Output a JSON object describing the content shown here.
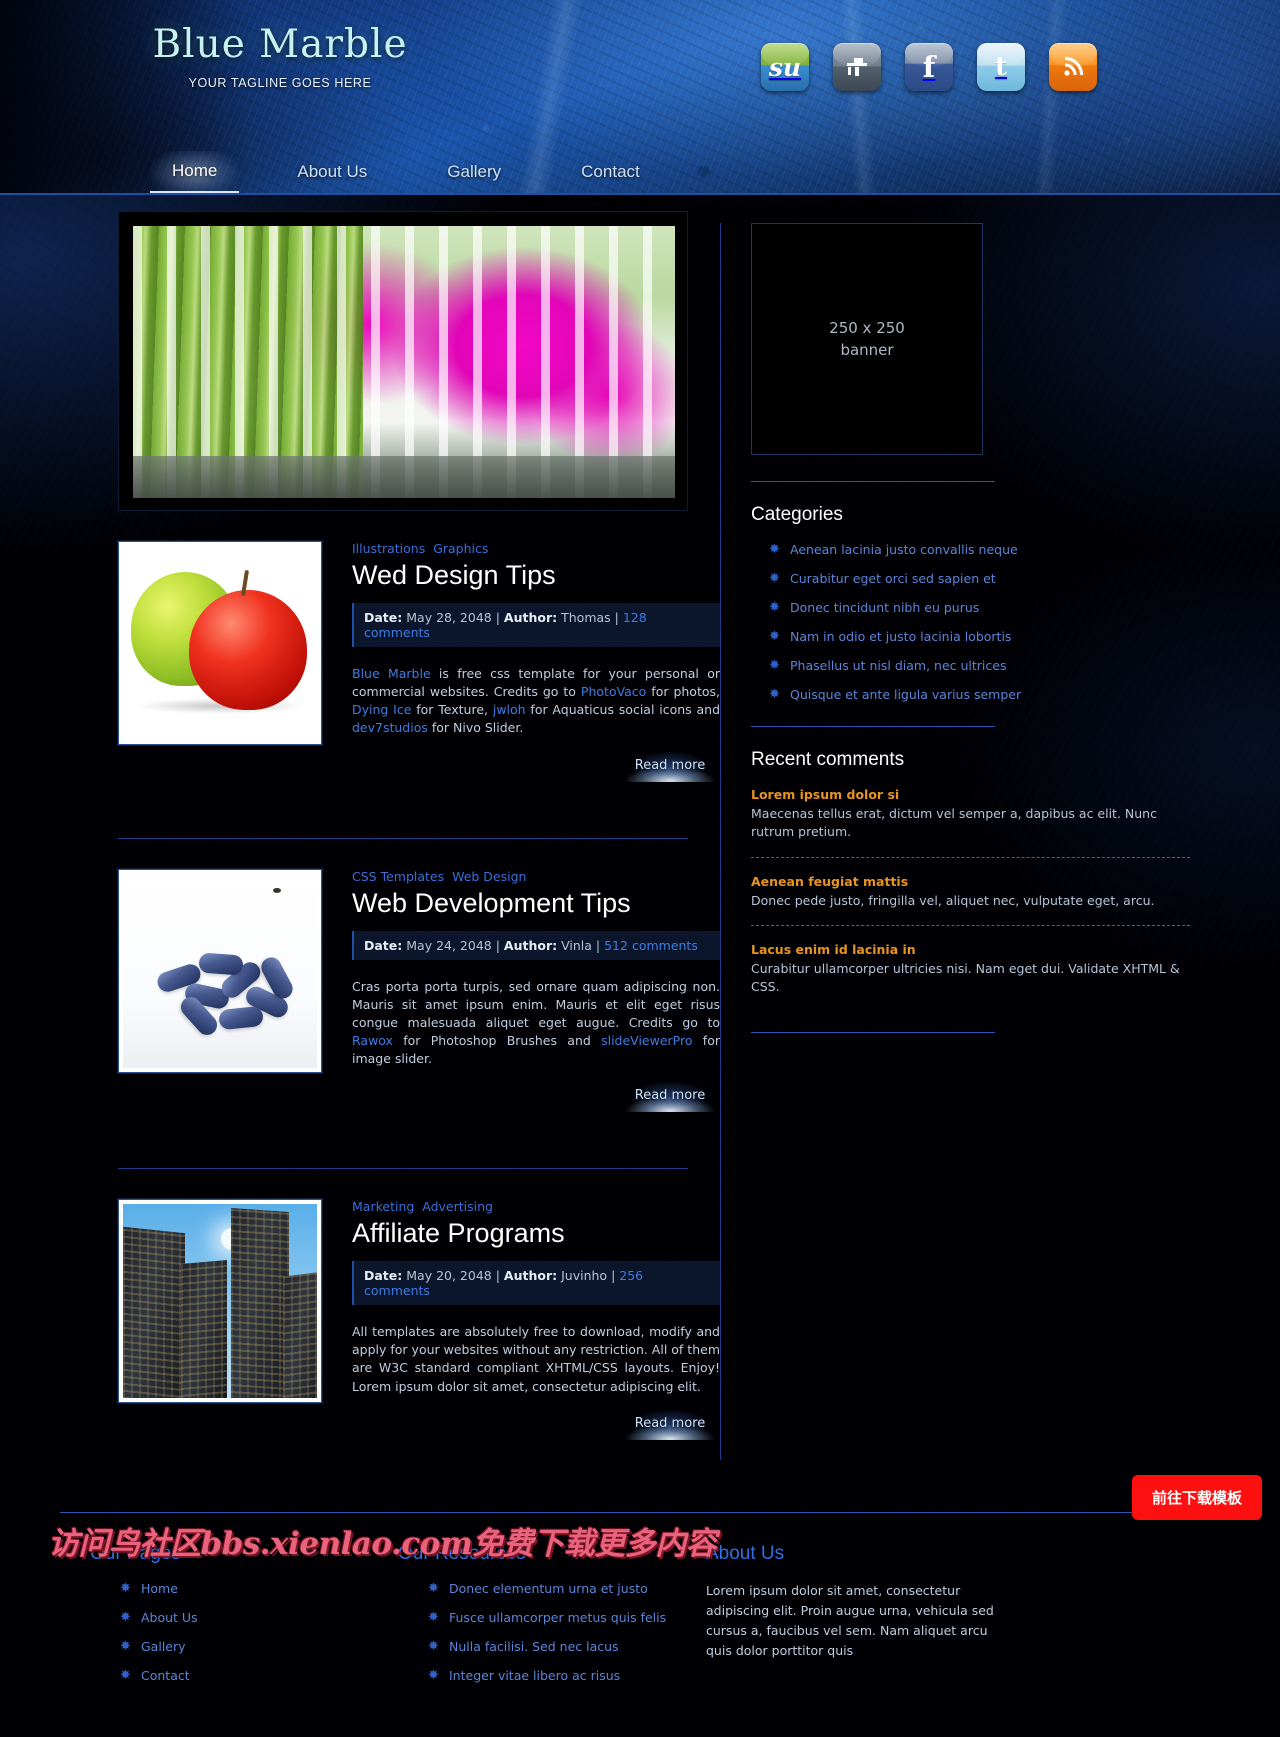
{
  "header": {
    "brand_title": "Blue Marble",
    "tagline": "YOUR TAGLINE GOES HERE",
    "socials": [
      {
        "name": "stumbleupon-icon",
        "glyph": "su"
      },
      {
        "name": "delicious-icon",
        "glyph": ""
      },
      {
        "name": "facebook-icon",
        "glyph": "f"
      },
      {
        "name": "twitter-icon",
        "glyph": "t"
      },
      {
        "name": "rss-icon",
        "glyph": ""
      }
    ],
    "nav": [
      {
        "label": "Home",
        "active": true
      },
      {
        "label": "About Us",
        "active": false
      },
      {
        "label": "Gallery",
        "active": false
      },
      {
        "label": "Contact",
        "active": false
      }
    ]
  },
  "slider": {
    "alt": "orchid-flowers-slide"
  },
  "posts": [
    {
      "categories": [
        "Illustrations",
        "Graphics"
      ],
      "title": "Wed Design Tips",
      "date_label": "Date:",
      "date": "May 28, 2048",
      "author_label": "Author:",
      "author": "Thomas",
      "comments": "128 comments",
      "text_parts": [
        {
          "t": "Blue Marble",
          "link": true
        },
        {
          "t": " is free css template for your personal or commercial websites. Credits go to ",
          "link": false
        },
        {
          "t": "PhotoVaco",
          "link": true
        },
        {
          "t": " for photos, ",
          "link": false
        },
        {
          "t": "Dying Ice",
          "link": true
        },
        {
          "t": " for Texture, ",
          "link": false
        },
        {
          "t": "jwloh",
          "link": true
        },
        {
          "t": " for Aquaticus social icons and ",
          "link": false
        },
        {
          "t": "dev7studios",
          "link": true
        },
        {
          "t": " for Nivo Slider.",
          "link": false
        }
      ],
      "read_more": "Read more",
      "thumb": "apples"
    },
    {
      "categories": [
        "CSS Templates",
        "Web Design"
      ],
      "title": "Web Development Tips",
      "date_label": "Date:",
      "date": "May 24, 2048",
      "author_label": "Author:",
      "author": "Vinla",
      "comments": "512 comments",
      "text_parts": [
        {
          "t": "Cras porta porta turpis, sed ornare quam adipiscing non. Mauris sit amet ipsum enim. Mauris et elit eget risus congue malesuada aliquet eget augue. Credits go to ",
          "link": false
        },
        {
          "t": "Rawox",
          "link": true
        },
        {
          "t": " for Photoshop Brushes and ",
          "link": false
        },
        {
          "t": "slideViewerPro",
          "link": true
        },
        {
          "t": " for image slider.",
          "link": false
        }
      ],
      "read_more": "Read more",
      "thumb": "pills"
    },
    {
      "categories": [
        "Marketing",
        "Advertising"
      ],
      "title": "Affiliate Programs",
      "date_label": "Date:",
      "date": "May 20, 2048",
      "author_label": "Author:",
      "author": "Juvinho",
      "comments": "256 comments",
      "text_parts": [
        {
          "t": "All templates are absolutely free to download, modify and apply for your websites without any restriction. All of them are W3C standard compliant XHTML/CSS layouts. Enjoy! Lorem ipsum dolor sit amet, consectetur adipiscing elit.",
          "link": false
        }
      ],
      "read_more": "Read more",
      "thumb": "buildings"
    }
  ],
  "sidebar": {
    "banner_line1": "250 x 250",
    "banner_line2": "banner",
    "categories_heading": "Categories",
    "categories": [
      "Aenean lacinia justo convallis neque",
      "Curabitur eget orci sed sapien et",
      "Donec tincidunt nibh eu purus",
      "Nam in odio et justo lacinia lobortis",
      "Phasellus ut nisl diam, nec ultrices",
      "Quisque et ante ligula varius semper"
    ],
    "comments_heading": "Recent comments",
    "comments": [
      {
        "title": "Lorem ipsum dolor si",
        "text": "Maecenas tellus erat, dictum vel semper a, dapibus ac elit. Nunc rutrum pretium."
      },
      {
        "title": "Aenean feugiat mattis",
        "text": "Donec pede justo, fringilla vel, aliquet nec, vulputate eget, arcu."
      },
      {
        "title": "Lacus enim id lacinia in",
        "text": "Curabitur ullamcorper ultricies nisi. Nam eget dui. Validate XHTML & CSS."
      }
    ]
  },
  "footer": {
    "columns": [
      {
        "heading": "Our Pages",
        "items": [
          "Home",
          "About Us",
          "Gallery",
          "Contact"
        ]
      },
      {
        "heading": "Our Resources",
        "items": [
          "Donec elementum urna et justo",
          "Fusce ullamcorper metus quis felis",
          "Nulla facilisi. Sed nec lacus",
          "Integer vitae libero ac risus"
        ]
      }
    ],
    "about_heading": "About Us",
    "about_text": "Lorem ipsum dolor sit amet, consectetur adipiscing elit. Proin augue urna, vehicula sed cursus a, faucibus vel sem. Nam aliquet arcu quis dolor porttitor quis"
  },
  "overlay": {
    "watermark": "访问鸟社区bbs.xienlao.com免费下载更多内容",
    "download_button": "前往下载模板"
  }
}
